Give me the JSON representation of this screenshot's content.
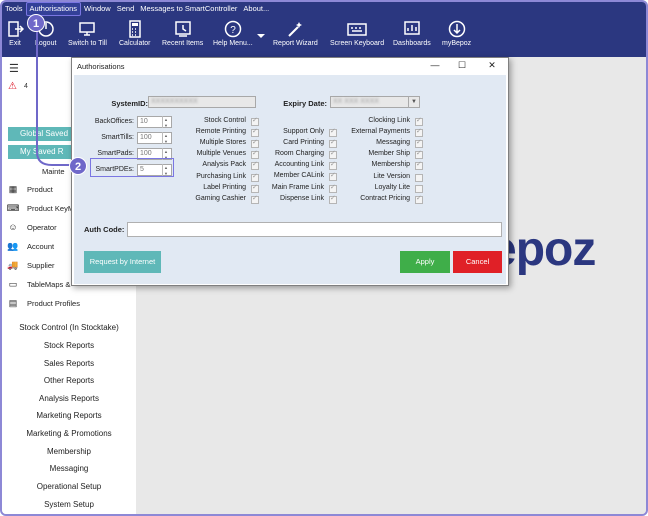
{
  "menu": [
    "Tools",
    "Authorisations",
    "Window",
    "Send",
    "Messages to SmartController",
    "About..."
  ],
  "toolbar": [
    {
      "label": "Exit",
      "icon": "exit-icon"
    },
    {
      "label": "Logout",
      "icon": "logout-icon"
    },
    {
      "label": "Switch to Till",
      "icon": "till-icon"
    },
    {
      "label": "Calculator",
      "icon": "calculator-icon"
    },
    {
      "label": "Recent Items",
      "icon": "recent-items-icon"
    },
    {
      "label": "Help Menu...",
      "icon": "help-icon"
    },
    {
      "label": "Report Wizard",
      "icon": "wand-icon"
    },
    {
      "label": "Screen Keyboard",
      "icon": "keyboard-icon"
    },
    {
      "label": "Dashboards",
      "icon": "dashboard-icon"
    },
    {
      "label": "myBepoz",
      "icon": "mybepoz-icon"
    }
  ],
  "left": {
    "warning_count": "4",
    "global_saved": "Global Saved",
    "my_saved": "My Saved R",
    "maintenance": "Mainte",
    "nav": [
      "Product",
      "Product KeyM",
      "Operator",
      "Account",
      "Supplier",
      "TableMaps &",
      "Product Profiles"
    ],
    "reports": [
      "Stock Control (In Stocktake)",
      "Stock Reports",
      "Sales Reports",
      "Other Reports",
      "Analysis Reports",
      "Marketing Reports",
      "Marketing & Promotions",
      "Membership",
      "Messaging",
      "Operational Setup",
      "System Setup"
    ]
  },
  "logo_text": "epoz",
  "dialog": {
    "title": "Authorisations",
    "system_id_label": "SystemID:",
    "system_id_value": "XXXXXXXXXX",
    "expiry_label": "Expiry Date:",
    "expiry_value": "XX XXX XXXX",
    "counts": [
      {
        "label": "BackOffices:",
        "value": "10"
      },
      {
        "label": "SmartTills:",
        "value": "100"
      },
      {
        "label": "SmartPads:",
        "value": "100"
      },
      {
        "label": "SmartPDEs:",
        "value": "5"
      }
    ],
    "col1": [
      {
        "label": "Stock Control",
        "checked": true
      },
      {
        "label": "Remote Printing",
        "checked": true
      },
      {
        "label": "Multiple Stores",
        "checked": true
      },
      {
        "label": "Multiple Venues",
        "checked": true
      },
      {
        "label": "Analysis Pack",
        "checked": true
      },
      {
        "label": "Purchasing Link",
        "checked": true
      },
      {
        "label": "Label Printing",
        "checked": true
      },
      {
        "label": "Gaming Cashier",
        "checked": true
      }
    ],
    "col2": [
      {
        "label": "Support Only",
        "checked": true
      },
      {
        "label": "Card Printing",
        "checked": true
      },
      {
        "label": "Room Charging",
        "checked": true
      },
      {
        "label": "Accounting Link",
        "checked": true
      },
      {
        "label": "Member CALink",
        "checked": true
      },
      {
        "label": "Main Frame Link",
        "checked": true
      },
      {
        "label": "Dispense Link",
        "checked": true
      }
    ],
    "col3": [
      {
        "label": "Clocking Link",
        "checked": true
      },
      {
        "label": "External Payments",
        "checked": true
      },
      {
        "label": "Messaging",
        "checked": true
      },
      {
        "label": "Member Ship",
        "checked": true
      },
      {
        "label": "Membership",
        "checked": true
      },
      {
        "label": "Lite Version",
        "checked": false
      },
      {
        "label": "Loyalty Lite",
        "checked": false
      },
      {
        "label": "Contract Pricing",
        "checked": true
      }
    ],
    "auth_code_label": "Auth Code:",
    "request_btn": "Request by Internet",
    "apply_btn": "Apply",
    "cancel_btn": "Cancel"
  },
  "callouts": [
    "1",
    "2"
  ],
  "colors": {
    "toolbar": "#2b3780",
    "apply": "#3fae49",
    "cancel": "#e02027",
    "request": "#5fb8b8",
    "callout": "#6f68c9"
  }
}
